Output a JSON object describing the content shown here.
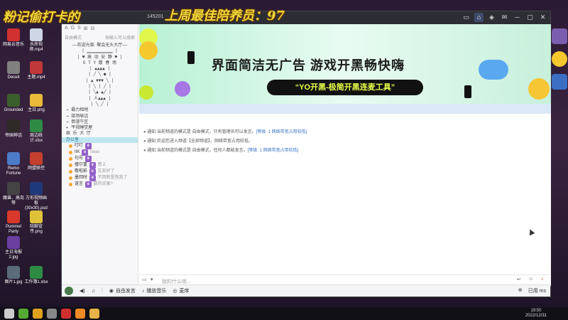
{
  "overlay": {
    "left_text": "粉记偷打卡的",
    "right_text": "上周最佳陪养员：97"
  },
  "window": {
    "room_id": "145201",
    "toolbar_icons": [
      "video-icon",
      "home-icon",
      "gamepad-icon",
      "mail-icon",
      "minimize-icon",
      "restore-icon",
      "close-icon"
    ]
  },
  "sidebar": {
    "tools": [
      "A",
      "G",
      "S",
      "⊞",
      "⊟"
    ],
    "search_label": "自由模式",
    "search_hint": "按输入可以搜索",
    "tree": [
      "——欢迎光临 聚会无头大厅——",
      "| ▁▁▁▁▁▁▁▁▁▁ |",
      "| ♥ 高 动 安 静 ♥ |",
      "E T Y 散  春  场",
      "|  ▲▲▲▲  |",
      "| ╱  ╲  ● |",
      "| ▲ ▼▼▼ ╲ |",
      "| ╲  |  ╱ |",
      "|  ╲▲ ▲╱ |",
      "| 人▲▲▲ |",
      "|  ╲ ╱  |",
      "→ 霸力相地",
      "→ 接场喻话",
      "→ 倒漫牛区",
      "▸ 平视睡觉屋",
      "娱 乐 大 厅"
    ],
    "selected": "办公室",
    "users": [
      {
        "name": "叮叮",
        "sub": ""
      },
      {
        "name": "IIK",
        "sub": "Seas"
      },
      {
        "name": "句号",
        "sub": ""
      },
      {
        "name": "撞尔重",
        "sub": "感上"
      },
      {
        "name": "敬啦影",
        "sub": "又安好了"
      },
      {
        "name": "墨回时",
        "sub": "不回新是抱我了"
      },
      {
        "name": "谊言",
        "sub": "要的说果?"
      }
    ],
    "overlay_chat": "给 你 (第33)哈哈GoGoGo哈哈 你 正在..."
  },
  "banner": {
    "headline": "界面简洁无广告  游戏开黑畅快嗨",
    "pill": "“YO开黑-极简开黑连麦工具”"
  },
  "messages": [
    {
      "prefix": "通知:",
      "text": "当前频道的模式是 自由模式，只有管理员可以发言。",
      "highlight": "[等级: 1 网络带宽占用较低]"
    },
    {
      "prefix": "通知:",
      "text": "欢迎您进入频道【全部频道】，网络带宽占用较低。",
      "highlight": ""
    },
    {
      "prefix": "通知:",
      "text": "当前频道的模式是 自由模式，任何人都能发言。",
      "highlight": "[等级: 1 网络带宽占用较低]"
    }
  ],
  "input": {
    "placeholder": "就的什么呢..."
  },
  "bottom_bar": {
    "items": [
      "自由发言",
      "播放音乐",
      "麦序"
    ],
    "right_items": [
      "↵",
      "☺",
      "♪"
    ],
    "right_status": "已用 ms"
  },
  "desktop_icons": [
    {
      "label": "网易云音乐",
      "color": "#d0302f"
    },
    {
      "label": "水房视频.mp4",
      "color": "#cfd6e6"
    },
    {
      "label": "Deceit",
      "color": "#808080"
    },
    {
      "label": "主题.mp4",
      "color": "#c03838"
    },
    {
      "label": "Grounded",
      "color": "#3b5f2c"
    },
    {
      "label": "主日.png",
      "color": "#eab93a"
    },
    {
      "label": "帝国神话",
      "color": "#2f2a26"
    },
    {
      "label": "周边统计.xlsx",
      "color": "#2e8b44"
    },
    {
      "label": "Remo Fortune",
      "color": "#4c7bc7"
    },
    {
      "label": "网盟联控",
      "color": "#c43f2d"
    },
    {
      "label": "魔兽、高岛等",
      "color": "#444"
    },
    {
      "label": "方形视频画板(30x30).psd",
      "color": "#1f3a7a"
    },
    {
      "label": "Pummel Party",
      "color": "#d8392b"
    },
    {
      "label": "陪聊宣传.png",
      "color": "#e0c23a"
    },
    {
      "label": "主日海报2.jpg",
      "color": "#6b3fa0"
    },
    {
      "label": "图片1.jpg",
      "color": "#5b6b7a"
    },
    {
      "label": "工作簿1.xlsx",
      "color": "#2e8b44"
    }
  ],
  "taskbar": {
    "time": "19:50",
    "date": "2022/12/31"
  }
}
